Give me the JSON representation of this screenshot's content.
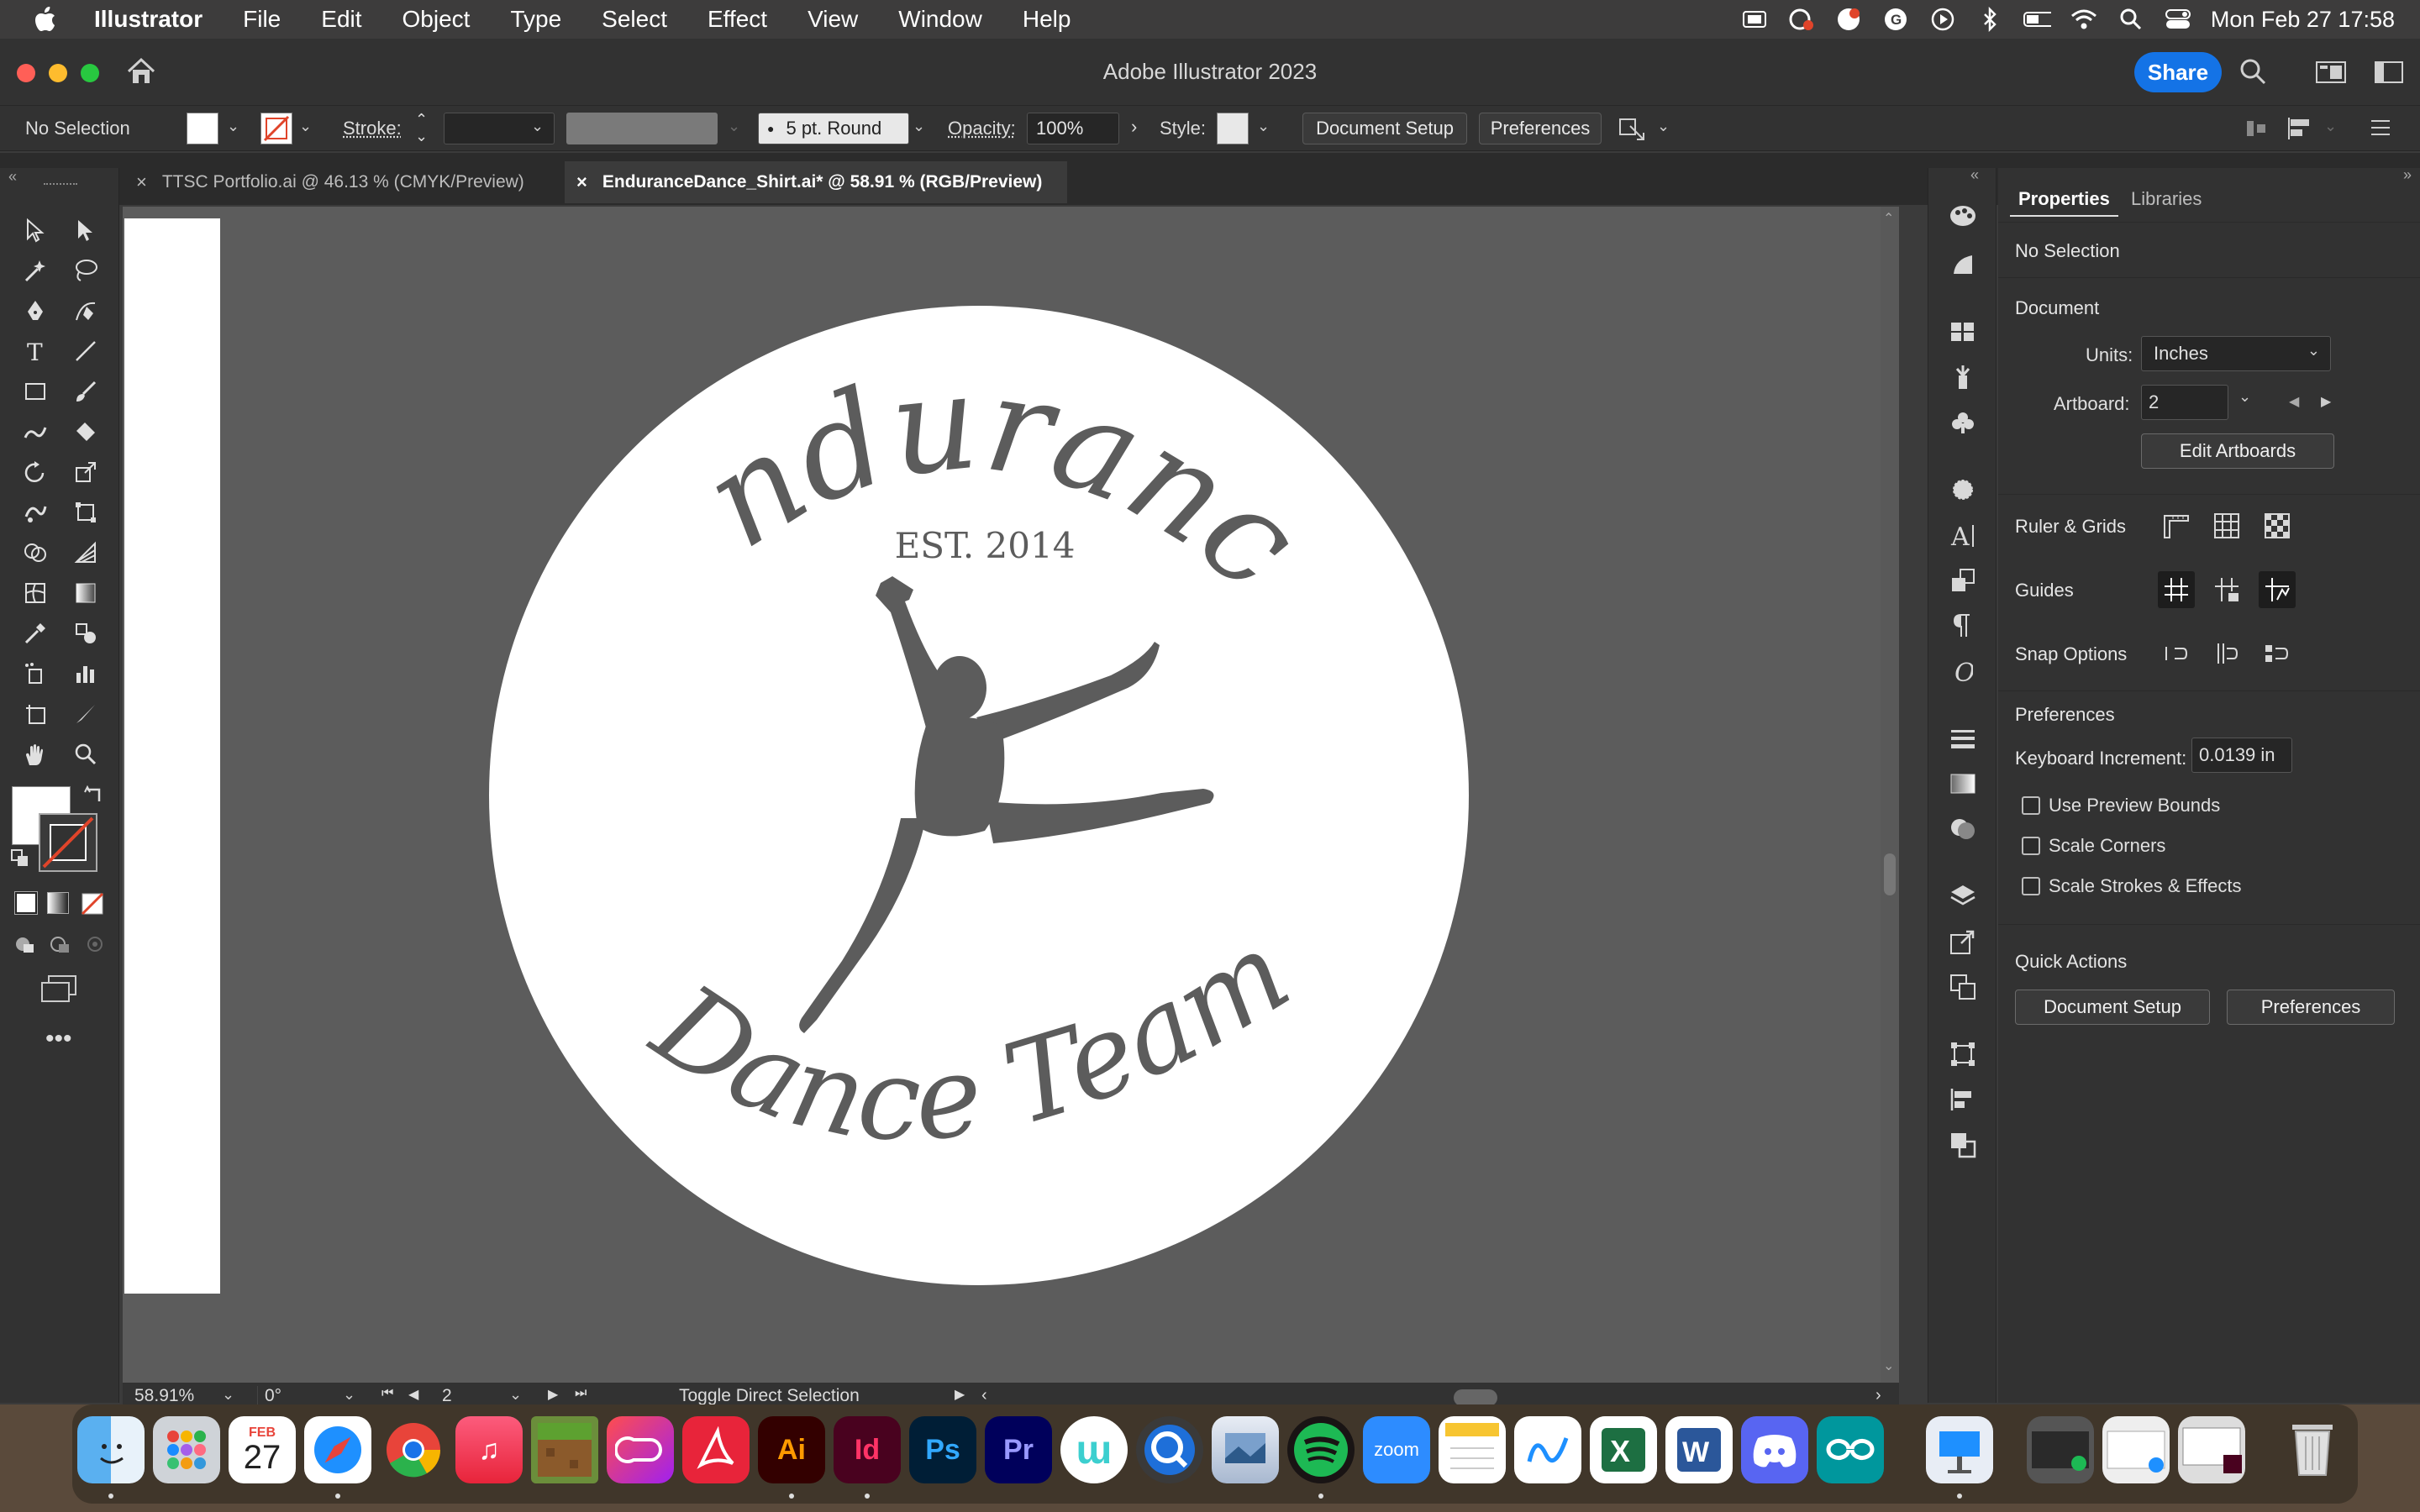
{
  "menubar": {
    "app_name": "Illustrator",
    "items": [
      "File",
      "Edit",
      "Object",
      "Type",
      "Select",
      "Effect",
      "View",
      "Window",
      "Help"
    ],
    "clock": "Mon Feb 27  17:58"
  },
  "window": {
    "title": "Adobe Illustrator 2023",
    "share_label": "Share"
  },
  "control_bar": {
    "selection_label": "No Selection",
    "stroke_label": "Stroke:",
    "brush_label": "5 pt. Round",
    "opacity_label": "Opacity:",
    "opacity_value": "100%",
    "style_label": "Style:",
    "document_setup_label": "Document Setup",
    "preferences_label": "Preferences"
  },
  "tabs": [
    {
      "label": "TTSC Portfolio.ai @ 46.13 % (CMYK/Preview)",
      "active": false
    },
    {
      "label": "EnduranceDance_Shirt.ai* @ 58.91 % (RGB/Preview)",
      "active": true
    }
  ],
  "artwork": {
    "top_text": "Endurance",
    "est_text": "EST. 2014",
    "bottom_text": "Dance Team"
  },
  "status_bar": {
    "zoom": "58.91%",
    "rotation": "0°",
    "artboard": "2",
    "status_text": "Toggle Direct Selection"
  },
  "properties": {
    "tab_properties": "Properties",
    "tab_libraries": "Libraries",
    "selection": "No Selection",
    "document_heading": "Document",
    "units_label": "Units:",
    "units_value": "Inches",
    "artboard_label": "Artboard:",
    "artboard_value": "2",
    "edit_artboards_label": "Edit Artboards",
    "ruler_grids_label": "Ruler & Grids",
    "guides_label": "Guides",
    "snap_options_label": "Snap Options",
    "preferences_heading": "Preferences",
    "keyboard_increment_label": "Keyboard Increment:",
    "keyboard_increment_value": "0.0139 in",
    "use_preview_bounds": "Use Preview Bounds",
    "scale_corners": "Scale Corners",
    "scale_strokes_effects": "Scale Strokes & Effects",
    "quick_actions_heading": "Quick Actions",
    "qa_document_setup": "Document Setup",
    "qa_preferences": "Preferences"
  },
  "dock": {
    "calendar_month": "FEB",
    "calendar_day": "27",
    "zoom_label": "zoom",
    "ai_label": "Ai",
    "id_label": "Id",
    "ps_label": "Ps",
    "pr_label": "Pr"
  },
  "colors": {
    "accent_blue": "#1473e6",
    "canvas_gray": "#5c5c5c",
    "panel_gray": "#323232"
  }
}
